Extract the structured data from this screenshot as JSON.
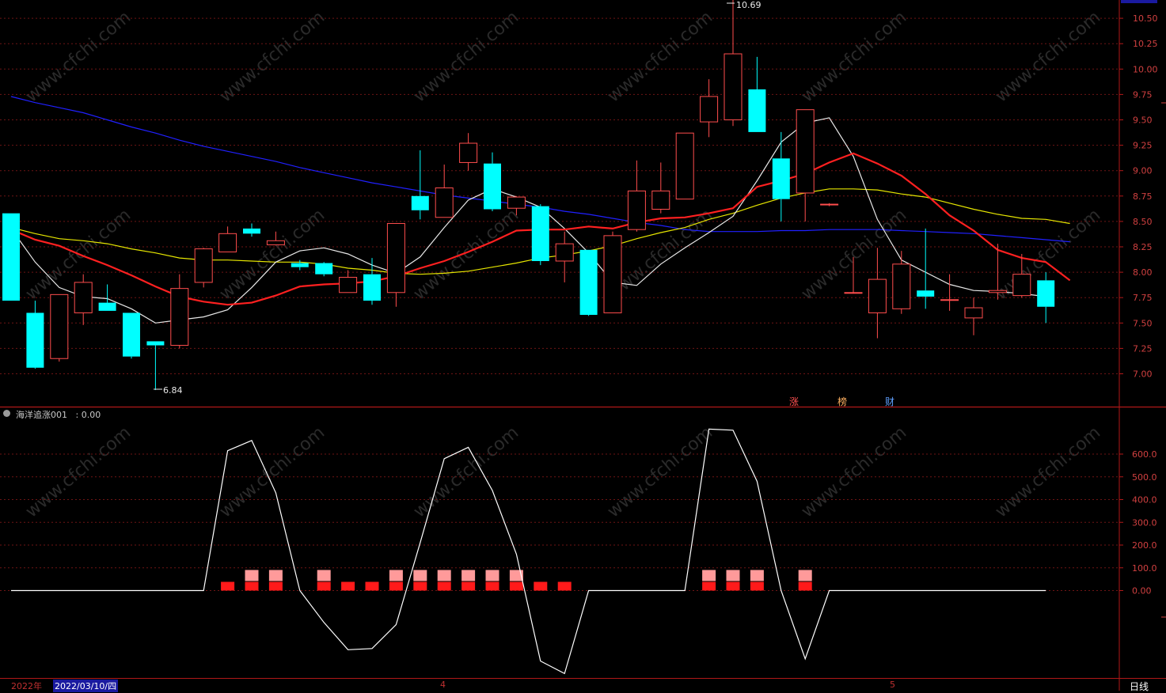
{
  "colors": {
    "up": "#ff4d4d",
    "down": "#00ffff",
    "ma5": "#e8e8e8",
    "ma10": "#ff2020",
    "ma20": "#e6e600",
    "ma60": "#2020ff",
    "grid": "#6e1414",
    "axis": "#b01818",
    "signal_dark": "#ff1a1a",
    "signal_light": "#ff9a9a"
  },
  "indicator": {
    "name": "海洋追涨001",
    "value_text": ": 0.00"
  },
  "date_bar": {
    "year": "2022年",
    "current_date": "2022/03/10/四",
    "month_apr": "4",
    "month_may": "5",
    "period": "日线"
  },
  "markers": {
    "zhang": "涨",
    "bang": "榜",
    "cai": "财"
  },
  "annotations": {
    "high_label": "10.69",
    "low_label": "6.84"
  },
  "chart_data": [
    {
      "type": "candlestick",
      "title": "",
      "ylim": [
        6.75,
        10.69
      ],
      "y_ticks": [
        "10.50",
        "10.25",
        "10.00",
        "9.75",
        "9.50",
        "9.25",
        "9.00",
        "8.75",
        "8.50",
        "8.25",
        "8.00",
        "7.75",
        "7.50",
        "7.25",
        "7.00"
      ],
      "candles": [
        {
          "o": 8.58,
          "h": 8.58,
          "l": 7.72,
          "c": 7.72
        },
        {
          "o": 7.6,
          "h": 7.72,
          "l": 7.05,
          "c": 7.06
        },
        {
          "o": 7.15,
          "h": 7.78,
          "l": 7.12,
          "c": 7.78
        },
        {
          "o": 7.6,
          "h": 7.98,
          "l": 7.48,
          "c": 7.9
        },
        {
          "o": 7.7,
          "h": 7.88,
          "l": 7.62,
          "c": 7.62
        },
        {
          "o": 7.6,
          "h": 7.6,
          "l": 7.15,
          "c": 7.17
        },
        {
          "o": 7.32,
          "h": 7.32,
          "l": 6.84,
          "c": 7.28
        },
        {
          "o": 7.28,
          "h": 7.98,
          "l": 7.25,
          "c": 7.84
        },
        {
          "o": 7.9,
          "h": 8.24,
          "l": 7.85,
          "c": 8.23
        },
        {
          "o": 8.2,
          "h": 8.45,
          "l": 8.2,
          "c": 8.38
        },
        {
          "o": 8.43,
          "h": 8.48,
          "l": 8.35,
          "c": 8.38
        },
        {
          "o": 8.27,
          "h": 8.4,
          "l": 8.27,
          "c": 8.31
        },
        {
          "o": 8.09,
          "h": 8.12,
          "l": 8.02,
          "c": 8.05
        },
        {
          "o": 8.09,
          "h": 8.1,
          "l": 7.96,
          "c": 7.98
        },
        {
          "o": 7.8,
          "h": 8.02,
          "l": 7.8,
          "c": 7.95
        },
        {
          "o": 7.98,
          "h": 8.14,
          "l": 7.68,
          "c": 7.72
        },
        {
          "o": 7.8,
          "h": 8.48,
          "l": 7.66,
          "c": 8.48
        },
        {
          "o": 8.75,
          "h": 9.2,
          "l": 8.52,
          "c": 8.61
        },
        {
          "o": 8.54,
          "h": 9.06,
          "l": 8.54,
          "c": 8.83
        },
        {
          "o": 9.08,
          "h": 9.37,
          "l": 9.0,
          "c": 9.27
        },
        {
          "o": 9.07,
          "h": 9.18,
          "l": 8.6,
          "c": 8.62
        },
        {
          "o": 8.63,
          "h": 8.75,
          "l": 8.56,
          "c": 8.74
        },
        {
          "o": 8.65,
          "h": 8.67,
          "l": 8.07,
          "c": 8.11
        },
        {
          "o": 8.11,
          "h": 8.4,
          "l": 7.9,
          "c": 8.28
        },
        {
          "o": 8.22,
          "h": 8.22,
          "l": 7.57,
          "c": 7.58
        },
        {
          "o": 7.6,
          "h": 8.4,
          "l": 7.6,
          "c": 8.36
        },
        {
          "o": 8.42,
          "h": 9.1,
          "l": 8.4,
          "c": 8.8
        },
        {
          "o": 8.62,
          "h": 9.08,
          "l": 8.58,
          "c": 8.8
        },
        {
          "o": 8.72,
          "h": 9.35,
          "l": 8.72,
          "c": 9.37
        },
        {
          "o": 9.48,
          "h": 9.9,
          "l": 9.33,
          "c": 9.73
        },
        {
          "o": 9.5,
          "h": 10.69,
          "l": 9.44,
          "c": 10.15
        },
        {
          "o": 9.8,
          "h": 10.12,
          "l": 9.38,
          "c": 9.38
        },
        {
          "o": 9.12,
          "h": 9.38,
          "l": 8.5,
          "c": 8.72
        },
        {
          "o": 8.78,
          "h": 9.6,
          "l": 8.5,
          "c": 9.6
        },
        {
          "o": 8.67,
          "h": 8.68,
          "l": 8.65,
          "c": 8.67
        },
        {
          "o": 7.8,
          "h": 8.15,
          "l": 7.79,
          "c": 7.8
        },
        {
          "o": 7.6,
          "h": 8.24,
          "l": 7.35,
          "c": 7.93
        },
        {
          "o": 7.64,
          "h": 8.21,
          "l": 7.59,
          "c": 8.08
        },
        {
          "o": 7.82,
          "h": 8.43,
          "l": 7.64,
          "c": 7.76
        },
        {
          "o": 7.73,
          "h": 7.98,
          "l": 7.62,
          "c": 7.73
        },
        {
          "o": 7.55,
          "h": 7.75,
          "l": 7.38,
          "c": 7.65
        },
        {
          "o": 7.8,
          "h": 8.28,
          "l": 7.73,
          "c": 7.82
        },
        {
          "o": 7.77,
          "h": 8.18,
          "l": 7.75,
          "c": 7.98
        },
        {
          "o": 7.92,
          "h": 8.0,
          "l": 7.5,
          "c": 7.66
        }
      ],
      "ma5": [
        8.43,
        8.1,
        7.85,
        7.76,
        7.74,
        7.64,
        7.5,
        7.53,
        7.56,
        7.63,
        7.85,
        8.1,
        8.21,
        8.24,
        8.18,
        8.07,
        7.99,
        8.15,
        8.44,
        8.71,
        8.82,
        8.74,
        8.64,
        8.43,
        8.19,
        7.9,
        7.87,
        8.08,
        8.24,
        8.39,
        8.55,
        8.9,
        9.28,
        9.47,
        9.52,
        9.14,
        8.52,
        8.12,
        8.0,
        7.88,
        7.82,
        7.81,
        7.79,
        7.76
      ],
      "ma10": [
        8.42,
        8.32,
        8.26,
        8.16,
        8.07,
        7.97,
        7.86,
        7.76,
        7.71,
        7.68,
        7.7,
        7.77,
        7.86,
        7.88,
        7.89,
        7.91,
        7.96,
        8.04,
        8.11,
        8.2,
        8.3,
        8.41,
        8.42,
        8.42,
        8.45,
        8.43,
        8.49,
        8.53,
        8.54,
        8.58,
        8.63,
        8.84,
        8.9,
        8.97,
        9.08,
        9.17,
        9.07,
        8.95,
        8.77,
        8.56,
        8.41,
        8.22,
        8.14,
        8.1,
        7.92
      ],
      "ma20": [
        8.44,
        8.38,
        8.33,
        8.31,
        8.28,
        8.23,
        8.19,
        8.14,
        8.12,
        8.12,
        8.11,
        8.1,
        8.1,
        8.08,
        8.04,
        8.02,
        7.99,
        7.98,
        7.99,
        8.01,
        8.05,
        8.09,
        8.14,
        8.17,
        8.21,
        8.26,
        8.33,
        8.39,
        8.44,
        8.52,
        8.58,
        8.66,
        8.73,
        8.78,
        8.82,
        8.82,
        8.81,
        8.77,
        8.74,
        8.68,
        8.62,
        8.57,
        8.53,
        8.52,
        8.48
      ],
      "ma60": [
        9.73,
        9.67,
        9.62,
        9.57,
        9.5,
        9.43,
        9.37,
        9.3,
        9.24,
        9.19,
        9.14,
        9.09,
        9.03,
        8.98,
        8.93,
        8.88,
        8.84,
        8.8,
        8.76,
        8.73,
        8.7,
        8.67,
        8.64,
        8.6,
        8.57,
        8.53,
        8.49,
        8.46,
        8.42,
        8.4,
        8.4,
        8.4,
        8.41,
        8.41,
        8.42,
        8.42,
        8.42,
        8.41,
        8.4,
        8.39,
        8.38,
        8.36,
        8.34,
        8.32,
        8.3
      ]
    },
    {
      "type": "line",
      "title": "海洋追涨001",
      "ylim": [
        -370,
        720
      ],
      "y_ticks": [
        "600.0",
        "500.0",
        "400.0",
        "300.0",
        "200.0",
        "100.0",
        "0.00"
      ],
      "values": [
        0,
        0,
        0,
        0,
        0,
        0,
        0,
        0,
        0,
        615,
        660,
        430,
        0,
        -140,
        -260,
        -255,
        -150,
        210,
        580,
        630,
        440,
        160,
        -310,
        -365,
        0,
        0,
        0,
        0,
        0,
        710,
        705,
        480,
        0,
        -300,
        0,
        0,
        0,
        0,
        0,
        0,
        0,
        0,
        0,
        0
      ],
      "signals": [
        {
          "i": 9,
          "type": "dark"
        },
        {
          "i": 10,
          "type": "both"
        },
        {
          "i": 11,
          "type": "both"
        },
        {
          "i": 13,
          "type": "both"
        },
        {
          "i": 14,
          "type": "dark"
        },
        {
          "i": 15,
          "type": "dark"
        },
        {
          "i": 16,
          "type": "both"
        },
        {
          "i": 17,
          "type": "both"
        },
        {
          "i": 18,
          "type": "both"
        },
        {
          "i": 19,
          "type": "both"
        },
        {
          "i": 20,
          "type": "both"
        },
        {
          "i": 21,
          "type": "both"
        },
        {
          "i": 22,
          "type": "dark"
        },
        {
          "i": 23,
          "type": "dark"
        },
        {
          "i": 29,
          "type": "both"
        },
        {
          "i": 30,
          "type": "both"
        },
        {
          "i": 31,
          "type": "both"
        },
        {
          "i": 33,
          "type": "both"
        }
      ]
    }
  ]
}
